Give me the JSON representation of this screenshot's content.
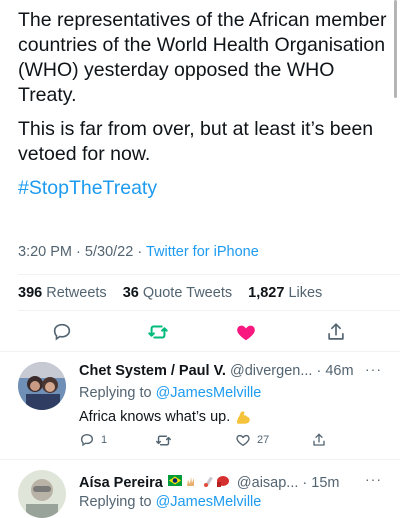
{
  "tweet": {
    "paragraph1": "The representatives of the African member countries of the World Health Organisation (WHO) yesterday opposed the WHO Treaty.",
    "paragraph2": "This is far from over, but at least it’s been vetoed for now.",
    "hashtag": "#StopTheTreaty",
    "time": "3:20 PM",
    "date": "5/30/22",
    "source": "Twitter for iPhone",
    "retweets_count": "396",
    "retweets_label": "Retweets",
    "quotes_count": "36",
    "quotes_label": "Quote Tweets",
    "likes_count": "1,827",
    "likes_label": "Likes"
  },
  "actions": {
    "reply_icon": "comment-icon",
    "retweet_icon": "retweet-icon",
    "like_icon": "heart-filled-icon",
    "share_icon": "share-icon",
    "like_color": "#f91880",
    "retweet_color": "#00ba7c"
  },
  "replies": [
    {
      "name": "Chet System / Paul V.",
      "handle": "@divergen...",
      "time": "46m",
      "replying_label": "Replying to",
      "replying_to": "@JamesMelville",
      "text": "Africa knows what’s up.",
      "replies": "1",
      "retweets": "",
      "likes": "27"
    },
    {
      "name": "Aísa Pereira",
      "handle": "@aisap...",
      "time": "15m",
      "replying_label": "Replying to",
      "replying_to": "@JamesMelville"
    }
  ],
  "dot_separator": "·",
  "more_label": "···"
}
